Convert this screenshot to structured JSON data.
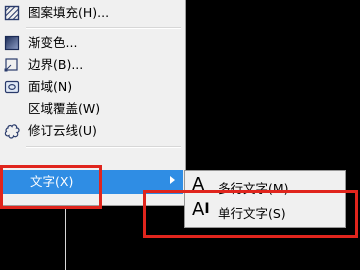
{
  "menu": {
    "items": [
      {
        "label": "图案填充(H)...",
        "icon": "hatch-icon"
      },
      {
        "label": "渐变色...",
        "icon": "gradient-icon"
      },
      {
        "label": "边界(B)...",
        "icon": "boundary-icon"
      },
      {
        "label": "面域(N)",
        "icon": "region-icon"
      },
      {
        "label": "区域覆盖(W)",
        "icon": "wipeout-icon"
      },
      {
        "label": "修订云线(U)",
        "icon": "revcloud-icon"
      },
      {
        "label": "文字(X)",
        "icon": "text-icon"
      }
    ]
  },
  "submenu": {
    "items": [
      {
        "label": "多行文字(M)...",
        "glyph": "A"
      },
      {
        "label": "单行文字(S)",
        "glyph": "AI"
      }
    ]
  },
  "colors": {
    "selected": "#2f8de4",
    "highlight_box": "#e0251d",
    "background": "#000000"
  }
}
